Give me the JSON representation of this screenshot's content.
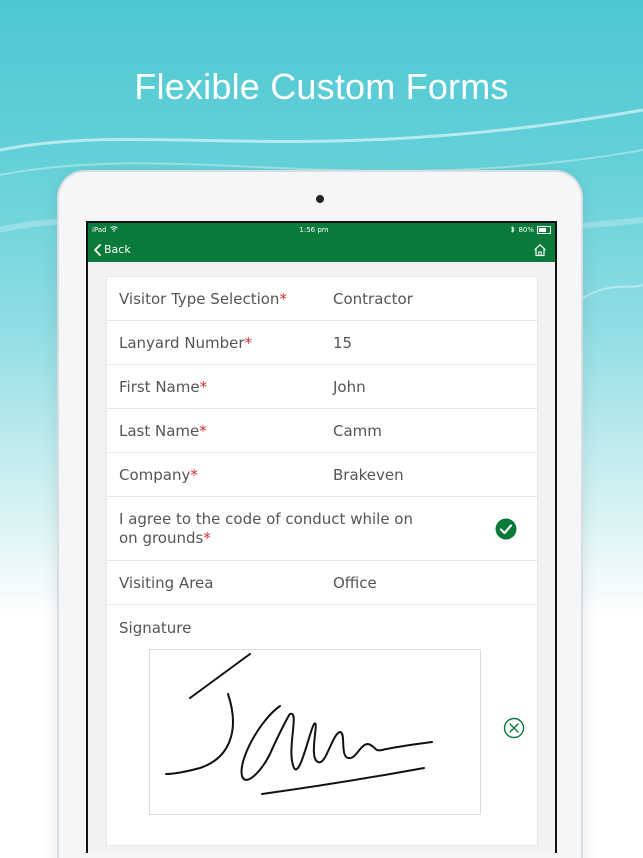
{
  "hero": {
    "title": "Flexible Custom Forms"
  },
  "statusbar": {
    "device": "iPad",
    "time": "1:56 pm",
    "battery": "80%"
  },
  "navbar": {
    "back_label": "Back",
    "back_icon": "chevron-left-icon",
    "home_icon": "home-icon"
  },
  "colors": {
    "accent": "#0a7a3a",
    "required": "#d0312d"
  },
  "form": {
    "fields": [
      {
        "label": "Visitor Type Selection",
        "required": "*",
        "value": "Contractor"
      },
      {
        "label": "Lanyard Number",
        "required": "*",
        "value": "15"
      },
      {
        "label": "First Name",
        "required": "*",
        "value": "John"
      },
      {
        "label": "Last Name",
        "required": "*",
        "value": "Camm"
      },
      {
        "label": "Company",
        "required": "*",
        "value": "Brakeven"
      }
    ],
    "agreement": {
      "label": "I agree to the code of conduct while on on grounds",
      "required": "*",
      "icon": "check-circle-icon"
    },
    "visiting_area": {
      "label": "Visiting Area",
      "value": "Office"
    },
    "signature": {
      "label": "Signature",
      "clear_icon": "clear-circle-icon"
    }
  }
}
